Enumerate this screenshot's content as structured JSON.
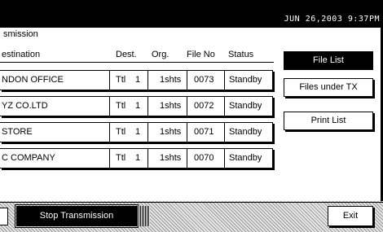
{
  "status_bar": {
    "datetime": "JUN  26,2003  9:37PM"
  },
  "panel": {
    "title": "smission"
  },
  "columns": {
    "destination": "estination",
    "dest": "Dest.",
    "org": "Org.",
    "file_no": "File No",
    "status": "Status"
  },
  "rows": [
    {
      "destination": "NDON OFFICE",
      "dest_type": "Ttl",
      "dest_count": "1",
      "org": "1shts",
      "file_no": "0073",
      "status": "Standby"
    },
    {
      "destination": "YZ CO.LTD",
      "dest_type": "Ttl",
      "dest_count": "1",
      "org": "1shts",
      "file_no": "0072",
      "status": "Standby"
    },
    {
      "destination": "STORE",
      "dest_type": "Ttl",
      "dest_count": "1",
      "org": "1shts",
      "file_no": "0071",
      "status": "Standby"
    },
    {
      "destination": "C COMPANY",
      "dest_type": "Ttl",
      "dest_count": "1",
      "org": "1shts",
      "file_no": "0070",
      "status": "Standby"
    }
  ],
  "side_buttons": {
    "file_list": "File List",
    "files_under_tx": "Files under TX",
    "print_list": "Print List"
  },
  "bottom": {
    "stop_transmission": "Stop Transmission",
    "exit": "Exit"
  }
}
